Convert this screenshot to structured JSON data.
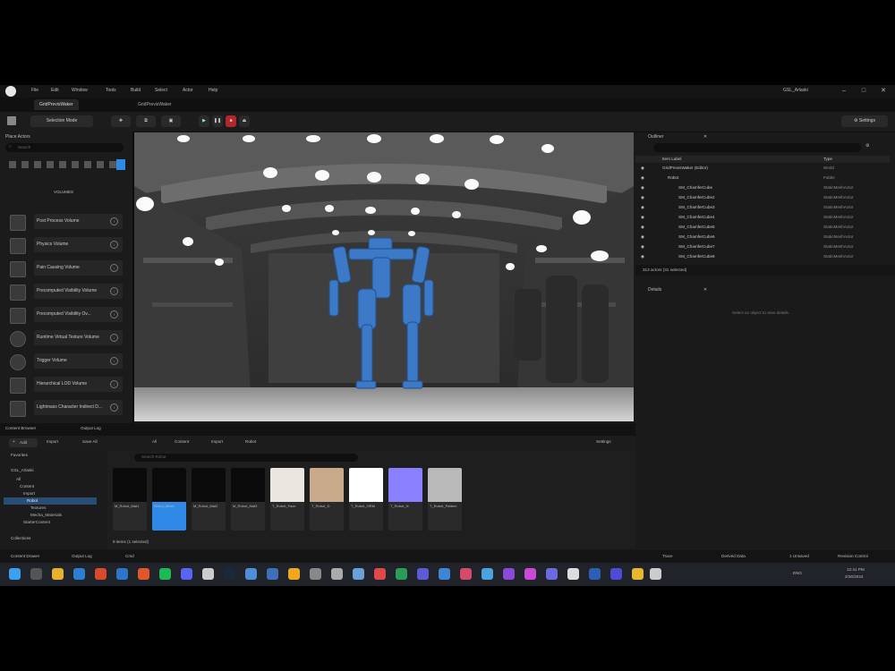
{
  "titlebar": {
    "menus": [
      "File",
      "Edit",
      "Window",
      "Tools",
      "Build",
      "Select",
      "Actor",
      "Help"
    ],
    "project": "GSL_Arlaski"
  },
  "tabs": [
    "GridPrevisWaker",
    "GridPrevisWaker"
  ],
  "toolbar": {
    "save_label": "Selection Mode",
    "settings_label": "Settings"
  },
  "left_panel": {
    "title": "Place Actors",
    "search_placeholder": "Search",
    "section_label": "VOLUMES",
    "items": [
      "Post Process Volume",
      "Physics Volume",
      "Pain Causing Volume",
      "Precomputed Visibility Volume",
      "Precomputed Visibility Ov...",
      "Runtime Virtual Texture Volume",
      "Trigger Volume",
      "Hierarchical LOD Volume",
      "Lightmass Character Indirect D..."
    ]
  },
  "outliner": {
    "title": "Outliner",
    "col_label": "Item Label",
    "col_type": "Type",
    "rows": [
      {
        "label": "GridPrevisWaker (Editor)",
        "type": "World"
      },
      {
        "label": "Robot",
        "type": "Folder"
      },
      {
        "label": "SM_ChamferCube",
        "type": "StaticMeshActor"
      },
      {
        "label": "SM_ChamferCube2",
        "type": "StaticMeshActor"
      },
      {
        "label": "SM_ChamferCube3",
        "type": "StaticMeshActor"
      },
      {
        "label": "SM_ChamferCube4",
        "type": "StaticMeshActor"
      },
      {
        "label": "SM_ChamferCube5",
        "type": "StaticMeshActor"
      },
      {
        "label": "SM_ChamferCube6",
        "type": "StaticMeshActor"
      },
      {
        "label": "SM_ChamferCube7",
        "type": "StaticMeshActor"
      },
      {
        "label": "SM_ChamferCube8",
        "type": "StaticMeshActor"
      }
    ],
    "footer": "313 actors (31 selected)"
  },
  "details": {
    "title": "Details",
    "empty_text": "Select an object to view details."
  },
  "content_browser": {
    "tabs": [
      "Content Browser",
      "Output Log"
    ],
    "add_label": "Add",
    "import_label": "Import",
    "save_all_label": "Save All",
    "breadcrumb": [
      "All",
      "Content",
      "Import",
      "Robot"
    ],
    "settings_label": "Settings",
    "search_placeholder": "Search Robot",
    "tree_title": "Favorites",
    "tree_root": "GSL_Arlaski",
    "tree_items": [
      "All",
      "Content",
      "Import",
      "Robot",
      "Textures",
      "Mecha_Materials",
      "StarterContent"
    ],
    "collections_label": "Collections",
    "item_count": "9 items (1 selected)",
    "assets": [
      {
        "name": "M_Robot_Mat1",
        "color": "#0a0a0a"
      },
      {
        "name": "Robot_Mesh",
        "color": "#0a0a0a"
      },
      {
        "name": "M_Robot_Mat2",
        "color": "#0a0a0a"
      },
      {
        "name": "M_Robot_Mat3",
        "color": "#0a0a0a"
      },
      {
        "name": "T_Robot_Face",
        "color": "#e9e6e0"
      },
      {
        "name": "T_Robot_D",
        "color": "#c8a98a"
      },
      {
        "name": "T_Robot_ORM",
        "color": "#ffffff"
      },
      {
        "name": "T_Robot_N",
        "color": "#8a80ff"
      },
      {
        "name": "T_Robot_Pattern",
        "color": "#b9b9b9"
      }
    ]
  },
  "statusbar": {
    "content_drawer": "Content Drawer",
    "output_log": "Output Log",
    "cmd": "Cmd",
    "trace": "Trace",
    "derived_data": "Derived Data",
    "unsaved": "1 Unsaved",
    "revision": "Revision Control"
  },
  "taskbar": {
    "time": "12:41 PM",
    "date": "2/26/2024",
    "lang": "ENG"
  },
  "colors": {
    "accent": "#2e8ae6",
    "panel": "#1b1b1b",
    "robot": "#3c79c6"
  }
}
